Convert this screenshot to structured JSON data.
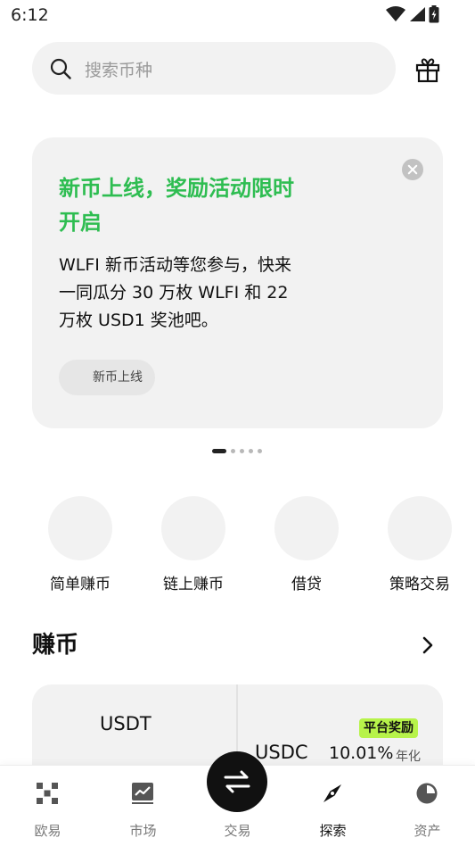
{
  "status_bar": {
    "time": "6:12"
  },
  "search": {
    "placeholder": "搜索币种"
  },
  "promo": {
    "title": "新币上线，奖励活动限时开启",
    "description": "WLFI 新币活动等您参与，快来一同瓜分 30 万枚 WLFI 和 22 万枚 USD1 奖池吧。",
    "tag": "新币上线",
    "pager": {
      "total": 5,
      "active_index": 0
    }
  },
  "categories": [
    {
      "label": "简单赚币"
    },
    {
      "label": "链上赚币"
    },
    {
      "label": "借贷"
    },
    {
      "label": "策略交易"
    }
  ],
  "earn": {
    "section_title": "赚币",
    "left": {
      "symbol": "USDT"
    },
    "right": {
      "badge": "平台奖励",
      "symbol": "USDC",
      "rate": "10.01%",
      "rate_unit": "年化"
    }
  },
  "bottom_nav": {
    "items": [
      {
        "label": "欧易",
        "icon": "okx-logo-icon"
      },
      {
        "label": "市场",
        "icon": "chart-icon"
      },
      {
        "label": "交易",
        "icon": "swap-icon"
      },
      {
        "label": "探索",
        "icon": "compass-icon",
        "active": true
      },
      {
        "label": "资产",
        "icon": "pie-chart-icon"
      }
    ]
  },
  "colors": {
    "accent_green": "#2ebd51",
    "badge_lime": "#b7f34a",
    "card_bg": "#f2f2f2"
  }
}
